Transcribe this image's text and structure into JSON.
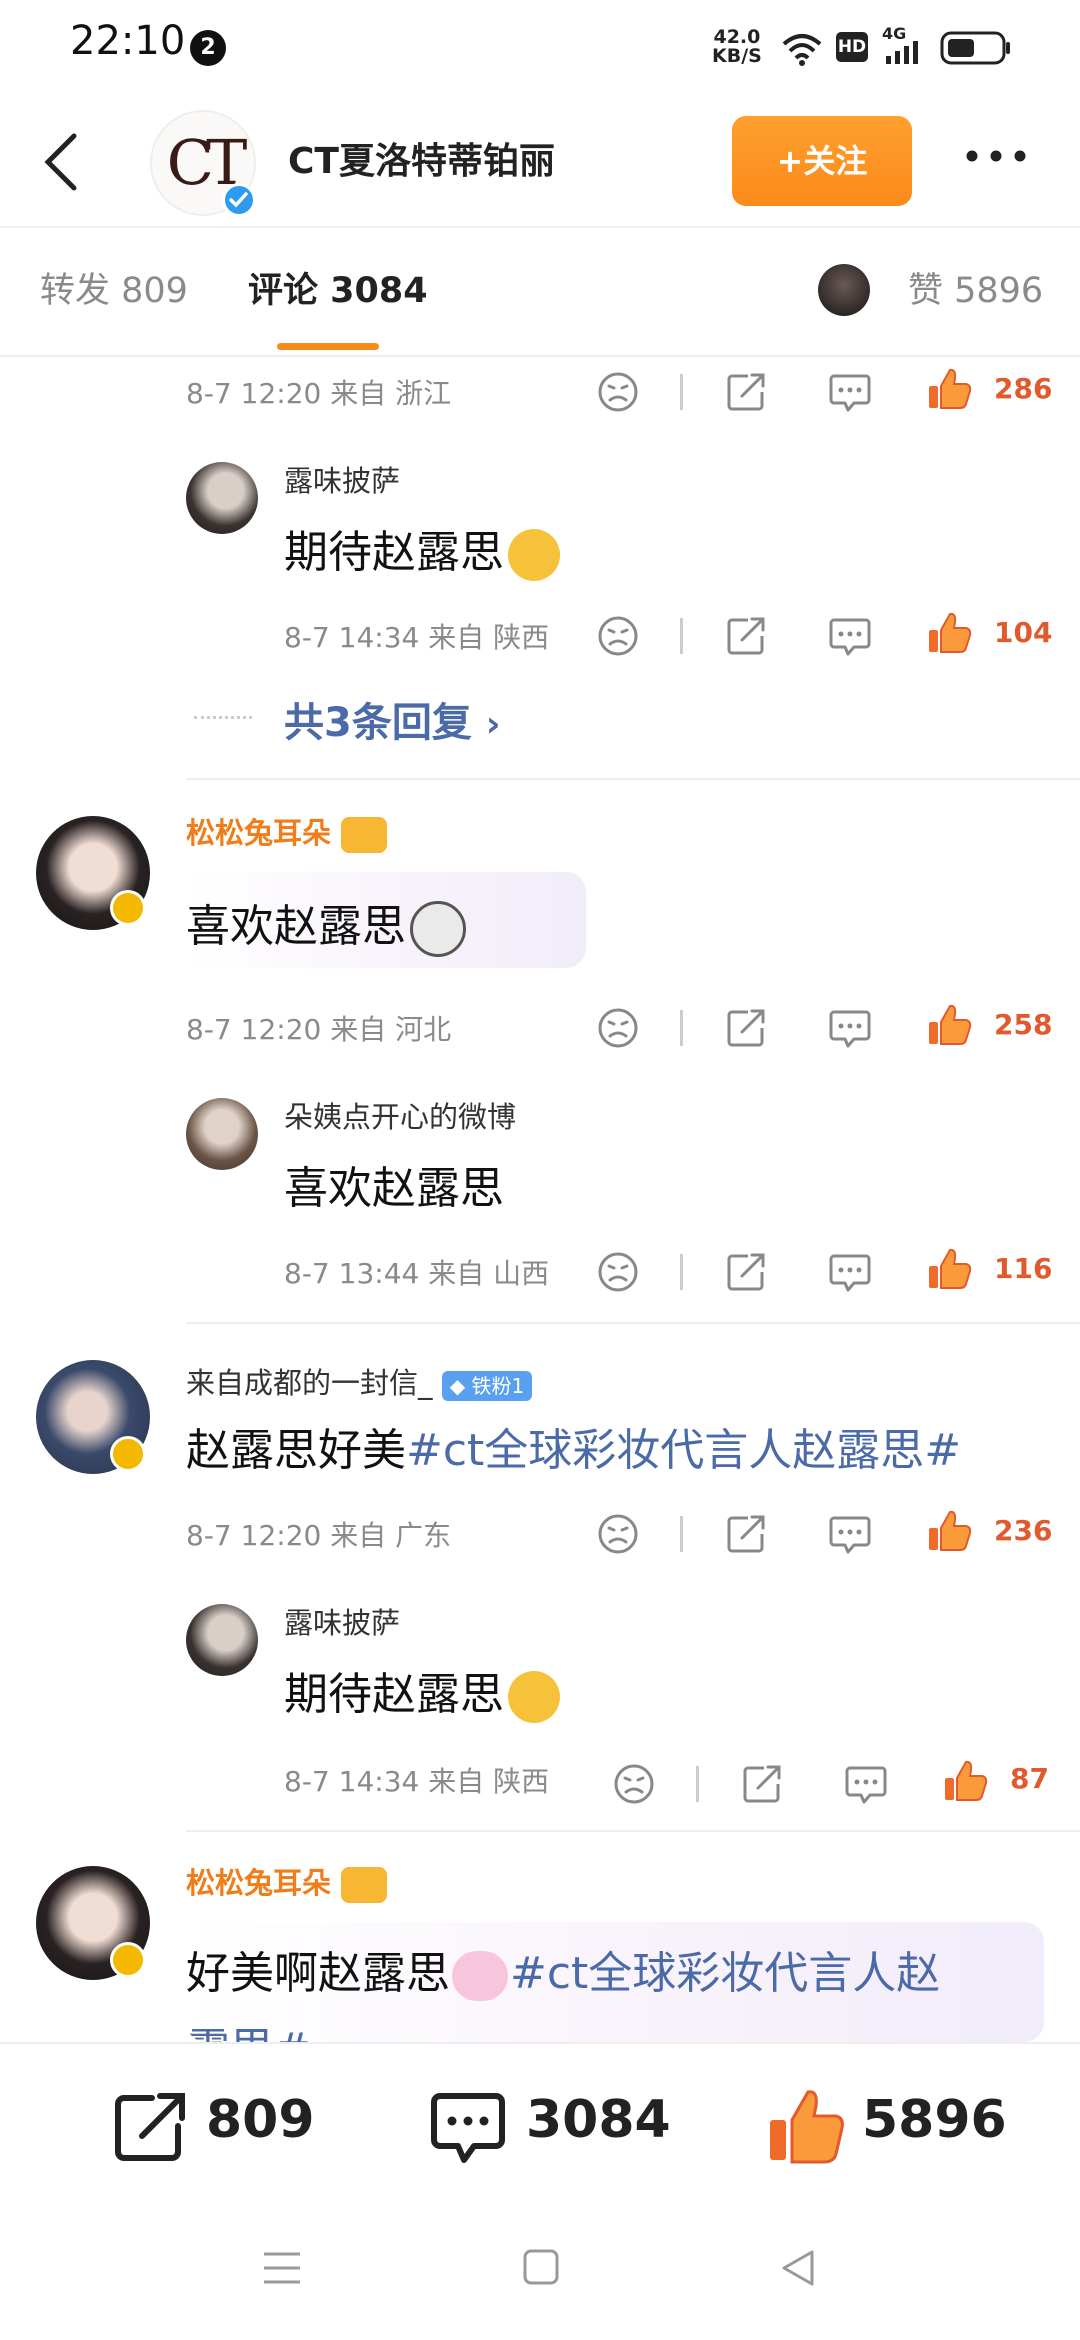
{
  "status": {
    "time": "22:10",
    "notif_count": "2",
    "speed_value": "42.0",
    "speed_unit": "KB/S",
    "hd": "HD",
    "net": "4G"
  },
  "header": {
    "account_name": "CT夏洛特蒂铂丽",
    "logo_text": "CT",
    "follow_label": "+关注"
  },
  "tabs": {
    "repost": "转发 809",
    "comment": "评论 3084",
    "like": "赞 5896"
  },
  "comments": [
    {
      "meta": "8-7 12:20  来自 浙江",
      "likes": "286"
    },
    {
      "name": "露味披萨",
      "text": "期待赵露思",
      "meta": "8-7 14:34  来自 陕西",
      "likes": "104"
    },
    {
      "replies": "共3条回复"
    },
    {
      "name": "松松兔耳朵",
      "text": "喜欢赵露思",
      "meta": "8-7 12:20  来自 河北",
      "likes": "258"
    },
    {
      "name": "朵姨点开心的微博",
      "text": "喜欢赵露思",
      "meta": "8-7 13:44  来自 山西",
      "likes": "116"
    },
    {
      "name": "来自成都的一封信_",
      "badge": "铁粉1",
      "text": "赵露思好美",
      "topic": "#ct全球彩妆代言人赵露思#",
      "meta": "8-7 12:20  来自 广东",
      "likes": "236"
    },
    {
      "name": "露味披萨",
      "text": "期待赵露思",
      "meta": "8-7 14:34  来自 陕西",
      "likes": "87"
    },
    {
      "name": "松松兔耳朵",
      "text": "好美啊赵露思",
      "topic": "#ct全球彩妆代言人赵",
      "topic2": "露思#"
    }
  ],
  "bottom": {
    "repost": "809",
    "comment": "3084",
    "like": "5896"
  },
  "colors": {
    "accent": "#fb8a1a",
    "topic": "#4a6aa8",
    "like": "#e05a2e"
  }
}
